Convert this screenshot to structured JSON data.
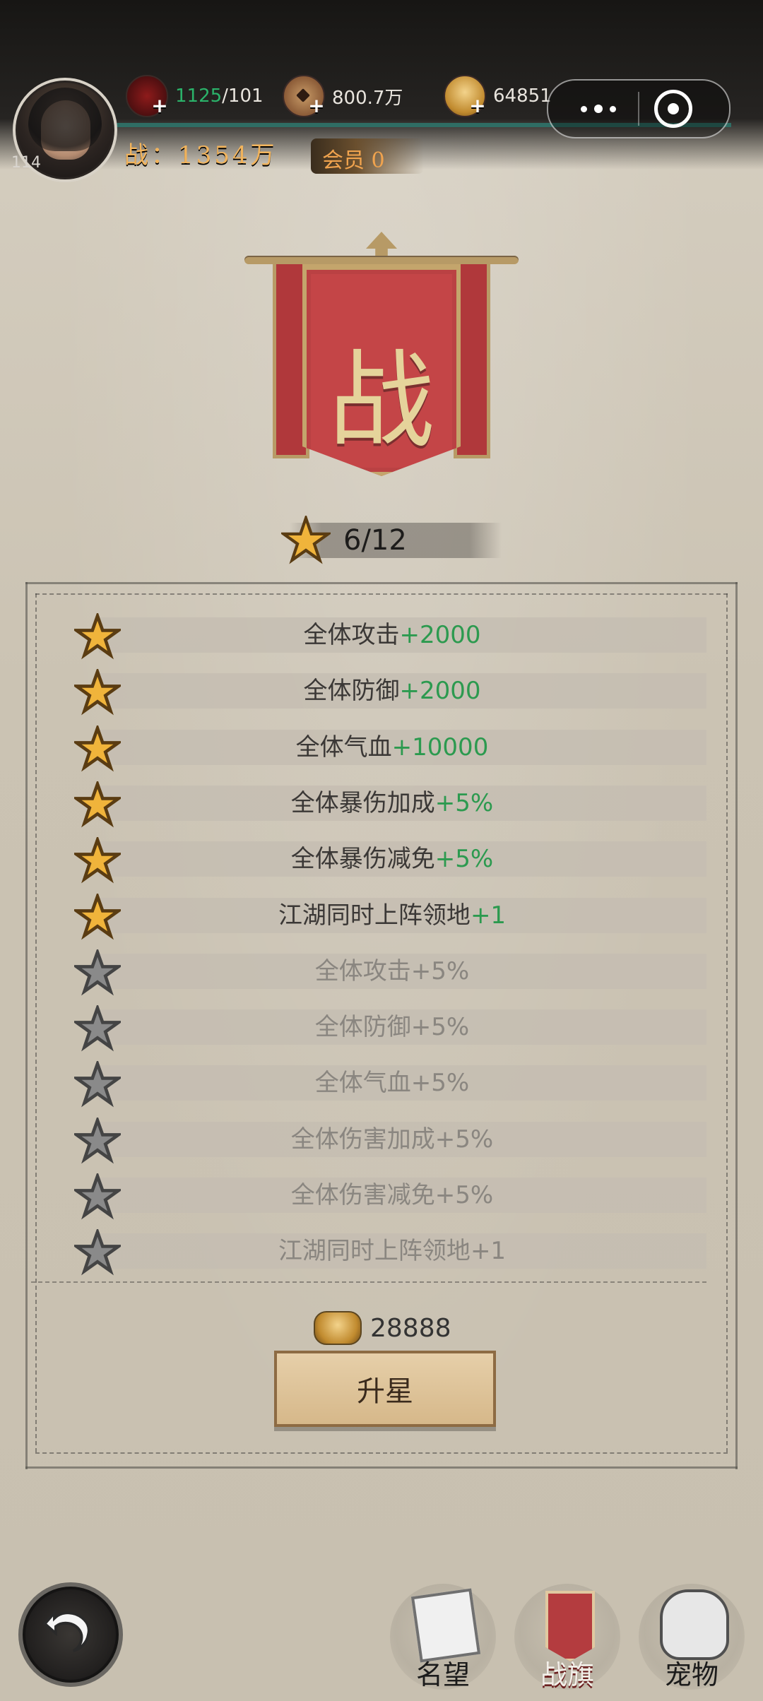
{
  "hud": {
    "level": "114",
    "resources": [
      {
        "name": "jar",
        "icon": "jar-icon",
        "value_current": "1125",
        "value_max": "/101"
      },
      {
        "name": "coin",
        "icon": "coin-icon",
        "value": "800.7万"
      },
      {
        "name": "ingot",
        "icon": "gold-ingot-icon",
        "value": "64851"
      }
    ],
    "power_text": "战：1354万",
    "vip_text": "会员 0",
    "capsule": {
      "more_icon": "more-dots-icon",
      "target_icon": "target-icon"
    }
  },
  "banner": {
    "glyph": "战"
  },
  "star_counter": {
    "text": "6/12"
  },
  "rows": [
    {
      "label": "全体攻击",
      "value": "+2000",
      "state": "active"
    },
    {
      "label": "全体防御",
      "value": "+2000",
      "state": "active"
    },
    {
      "label": "全体气血",
      "value": "+10000",
      "state": "active"
    },
    {
      "label": "全体暴伤加成",
      "value": "+5%",
      "state": "active"
    },
    {
      "label": "全体暴伤减免",
      "value": "+5%",
      "state": "active"
    },
    {
      "label": "江湖同时上阵领地",
      "value": "+1",
      "state": "active"
    },
    {
      "label": "全体攻击",
      "value": "+5%",
      "state": "locked"
    },
    {
      "label": "全体防御",
      "value": "+5%",
      "state": "locked"
    },
    {
      "label": "全体气血",
      "value": "+5%",
      "state": "locked"
    },
    {
      "label": "全体伤害加成",
      "value": "+5%",
      "state": "locked"
    },
    {
      "label": "全体伤害减免",
      "value": "+5%",
      "state": "locked"
    },
    {
      "label": "江湖同时上阵领地",
      "value": "+1",
      "state": "locked"
    }
  ],
  "cost": {
    "icon": "gold-ingot-icon",
    "value": "28888"
  },
  "upgrade_button": {
    "label": "升星"
  },
  "bottom_nav": [
    {
      "label": "名望",
      "icon": "document-icon",
      "active": false
    },
    {
      "label": "战旗",
      "icon": "banner-icon",
      "active": true
    },
    {
      "label": "宠物",
      "icon": "pet-icon",
      "active": false
    }
  ],
  "colors": {
    "accent_green": "#2c9a4f",
    "star_gold": "#f0b43b",
    "star_gray": "#8a8a8a"
  }
}
